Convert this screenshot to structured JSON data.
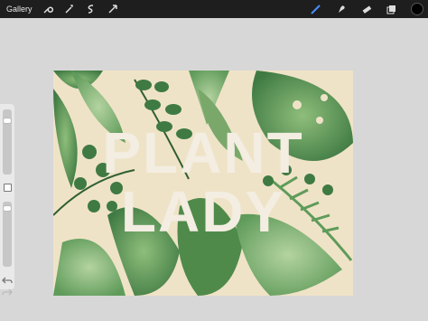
{
  "toolbar": {
    "gallery_label": "Gallery",
    "left_tools": [
      "wrench-icon",
      "magic-wand-icon",
      "selection-icon",
      "transform-arrow-icon"
    ],
    "right_tools": [
      "brush-icon",
      "smudge-icon",
      "eraser-icon",
      "layers-icon"
    ],
    "active_tool": "brush-icon",
    "active_color": "#000000"
  },
  "canvas": {
    "title_line1": "PLANT",
    "title_line2": "LADY",
    "colors": {
      "background": "#efe3c7",
      "leaf_dark": "#3f7a43",
      "leaf_mid": "#5f9b5a",
      "leaf_light": "#9fc38a",
      "text": "#f3ede2"
    }
  },
  "sidebar": {
    "brush_size": 0.85,
    "opacity": 0.92
  }
}
